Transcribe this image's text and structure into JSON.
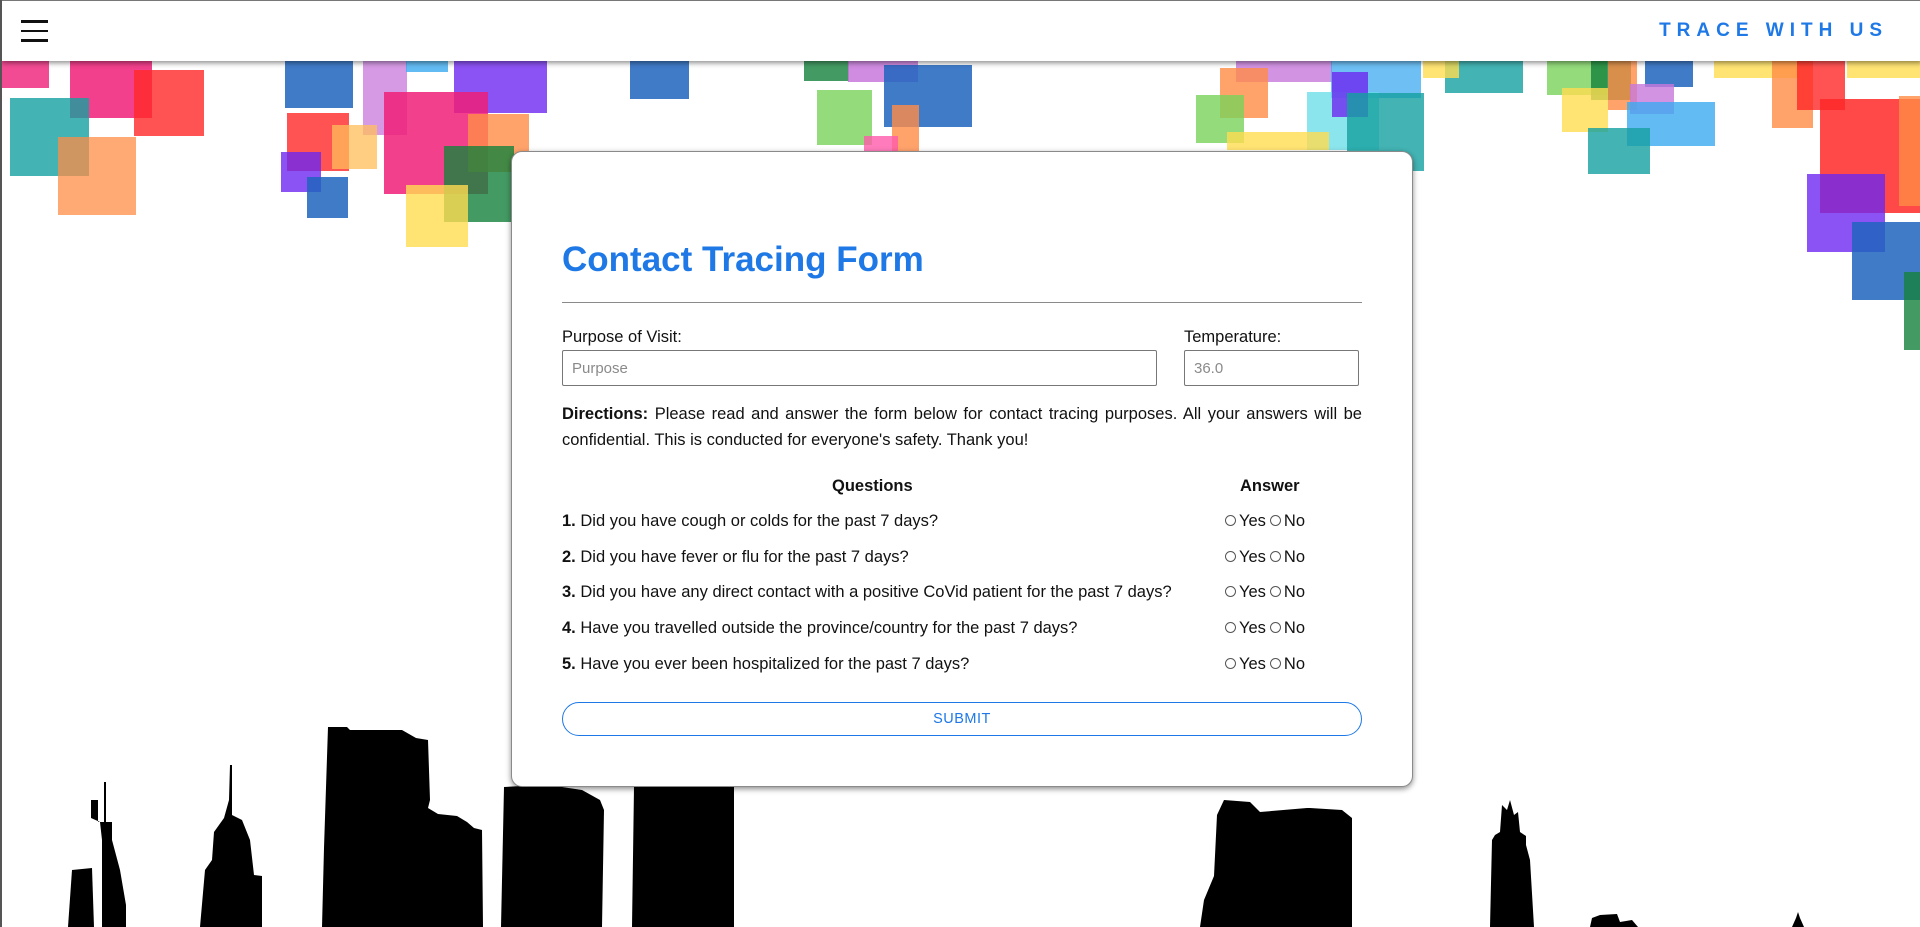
{
  "navbar": {
    "brand": "TRACE WITH US",
    "menu_icon": "hamburger-menu-icon"
  },
  "form": {
    "title": "Contact Tracing Form",
    "purpose_label": "Purpose of Visit:",
    "purpose_placeholder": "Purpose",
    "purpose_value": "",
    "temperature_label": "Temperature:",
    "temperature_placeholder": "36.0",
    "temperature_value": "",
    "directions_label": "Directions:",
    "directions_text": "Please read and answer the form below for contact tracing purposes. All your answers will be confidential. This is conducted for everyone's safety. Thank you!",
    "questions_header": "Questions",
    "answer_header": "Answer",
    "questions": [
      {
        "num": "1.",
        "text": "Did you have cough or colds for the past 7 days?",
        "yes": "Yes",
        "no": "No",
        "selected": null
      },
      {
        "num": "2.",
        "text": "Did you have fever or flu for the past 7 days?",
        "yes": "Yes",
        "no": "No",
        "selected": null
      },
      {
        "num": "3.",
        "text": "Did you have any direct contact with a positive CoVid patient for the past 7 days?",
        "yes": "Yes",
        "no": "No",
        "selected": null
      },
      {
        "num": "4.",
        "text": "Have you travelled outside the province/country for the past 7 days?",
        "yes": "Yes",
        "no": "No",
        "selected": null
      },
      {
        "num": "5.",
        "text": "Have you ever been hospitalized for the past 7 days?",
        "yes": "Yes",
        "no": "No",
        "selected": null
      }
    ],
    "submit_label": "SUBMIT"
  },
  "colors": {
    "accent": "#1e78e6",
    "background": "#ffffff",
    "skyline": "#000000"
  }
}
